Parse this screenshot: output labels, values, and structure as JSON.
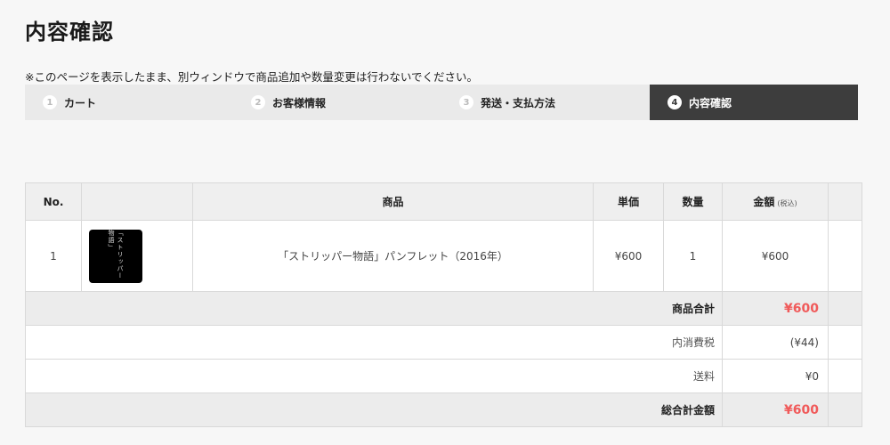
{
  "page_title": "内容確認",
  "notice": "※このページを表示したまま、別ウィンドウで商品追加や数量変更は行わないでください。",
  "steps": [
    {
      "num": "1",
      "label": "カート"
    },
    {
      "num": "2",
      "label": "お客様情報"
    },
    {
      "num": "3",
      "label": "発送・支払方法"
    },
    {
      "num": "4",
      "label": "内容確認"
    }
  ],
  "table": {
    "headers": {
      "no": "No.",
      "image": "",
      "product": "商品",
      "unit_price": "単価",
      "quantity": "数量",
      "amount": "金額",
      "amount_note": "(税込)"
    },
    "items": [
      {
        "no": "1",
        "thumb_text": "「ストリッパー物語」",
        "name": "「ストリッパー物語」パンフレット（2016年）",
        "unit_price": "¥600",
        "quantity": "1",
        "amount": "¥600"
      }
    ],
    "summary": {
      "subtotal_label": "商品合計",
      "subtotal_value": "¥600",
      "tax_label": "内消費税",
      "tax_value": "(¥44)",
      "shipping_label": "送料",
      "shipping_value": "¥0",
      "total_label": "総合計金額",
      "total_value": "¥600"
    }
  },
  "colors": {
    "accent_red": "#f05a5a",
    "active_step_bg": "#3d3d3d"
  }
}
